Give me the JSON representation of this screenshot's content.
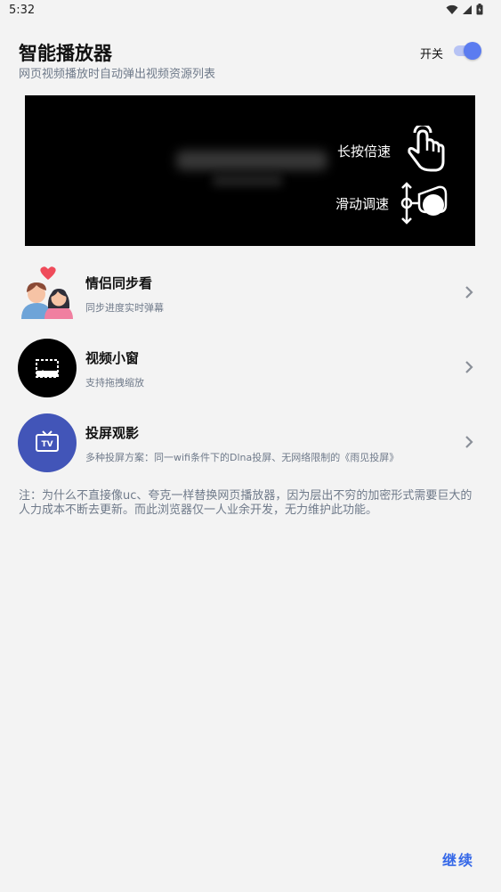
{
  "status_bar": {
    "time": "5:32",
    "icons": [
      "wifi-icon",
      "signal-icon",
      "battery-icon"
    ]
  },
  "header": {
    "title": "智能播放器",
    "subtitle": "网页视频播放时自动弹出视频资源列表",
    "toggle_label": "开关",
    "toggle_on": true
  },
  "video_preview": {
    "gestures": [
      {
        "label": "长按倍速",
        "icon": "tap-hand-icon"
      },
      {
        "label": "滑动调速",
        "icon": "swipe-drag-icon"
      }
    ]
  },
  "features": [
    {
      "title": "情侣同步看",
      "desc": "同步进度实时弹幕",
      "icon": "couple-icon"
    },
    {
      "title": "视频小窗",
      "desc": "支持拖拽缩放",
      "icon": "picture-in-picture-icon"
    },
    {
      "title": "投屏观影",
      "desc": "多种投屏方案：同一wifi条件下的Dlna投屏、无网络限制的《雨见投屏》",
      "icon": "tv-icon"
    }
  ],
  "note": "注：为什么不直接像uc、夸克一样替换网页播放器，因为层出不穷的加密形式需要巨大的人力成本不断去更新。而此浏览器仅一人业余开发，无力维护此功能。",
  "footer": {
    "continue_label": "继续"
  },
  "colors": {
    "accent": "#3568e8",
    "toggle": "#5b7cf0",
    "secondary_text": "#6f7a8a",
    "background": "#f3f3f3"
  }
}
